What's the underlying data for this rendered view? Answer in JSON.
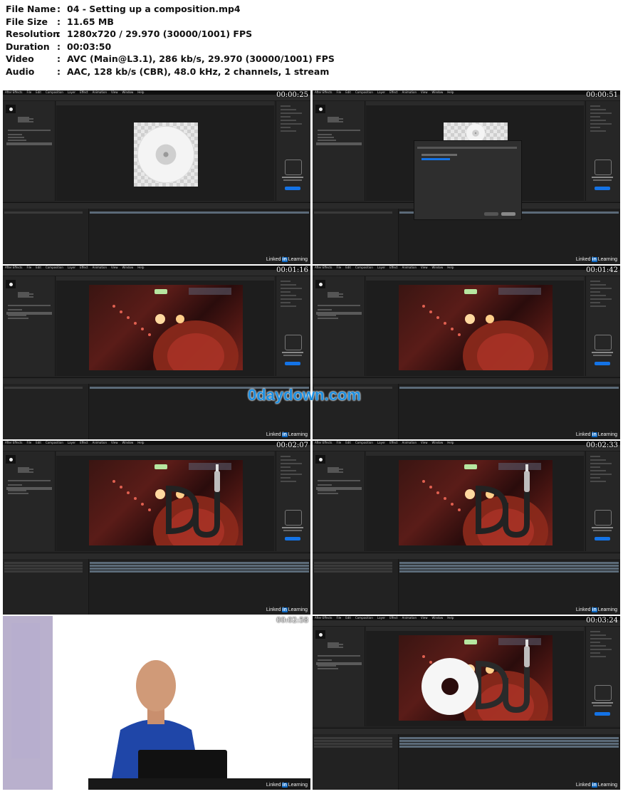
{
  "meta": {
    "rows": [
      {
        "key": "File Name",
        "value": "04 - Setting up a composition.mp4"
      },
      {
        "key": "File Size",
        "value": "11.65 MB"
      },
      {
        "key": "Resolution",
        "value": "1280x720 / 29.970 (30000/1001) FPS"
      },
      {
        "key": "Duration",
        "value": "00:03:50"
      },
      {
        "key": "Video",
        "value": "AVC (Main@L3.1), 286 kb/s, 29.970 (30000/1001) FPS"
      },
      {
        "key": "Audio",
        "value": "AAC, 128 kb/s (CBR), 48.0 kHz, 2 channels, 1 stream"
      }
    ],
    "colon": ":"
  },
  "thumbnails": [
    {
      "timestamp": "00:00:25"
    },
    {
      "timestamp": "00:00:51"
    },
    {
      "timestamp": "00:01:16"
    },
    {
      "timestamp": "00:01:42"
    },
    {
      "timestamp": "00:02:07"
    },
    {
      "timestamp": "00:02:33"
    },
    {
      "timestamp": "00:02:58"
    },
    {
      "timestamp": "00:03:24"
    }
  ],
  "ae_menu": [
    "After Effects",
    "File",
    "Edit",
    "Composition",
    "Layer",
    "Effect",
    "Animation",
    "View",
    "Window",
    "Help"
  ],
  "library": {
    "title": "Organize libraries",
    "subtitle": "your way",
    "button": "Create Group"
  },
  "watermark": {
    "pre": "Linked",
    "in": "in",
    "post": "Learning"
  },
  "daydown": "0daydown.com",
  "colors": {
    "linkedin_blue": "#0a66c2",
    "ae_dark": "#232323",
    "daydown_blue": "#1e8fe0"
  }
}
